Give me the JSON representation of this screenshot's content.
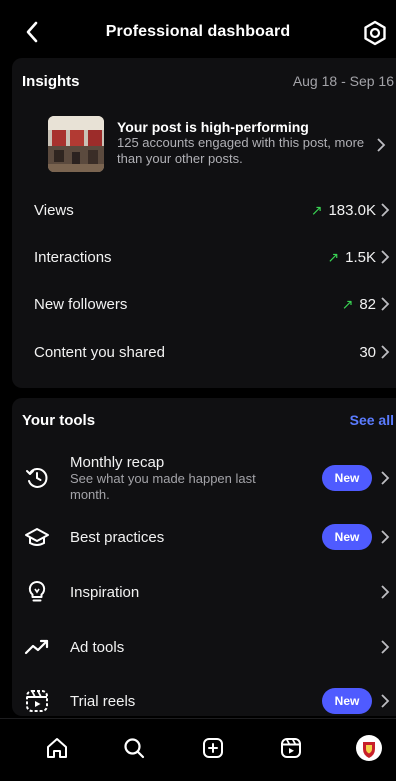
{
  "header": {
    "title": "Professional dashboard"
  },
  "insights": {
    "heading": "Insights",
    "date_range": "Aug 18 - Sep 16",
    "post": {
      "title": "Your post is high-performing",
      "description": "125 accounts engaged with this post, more than your other posts."
    },
    "metrics": [
      {
        "label": "Views",
        "value": "183.0K",
        "trend": "up"
      },
      {
        "label": "Interactions",
        "value": "1.5K",
        "trend": "up"
      },
      {
        "label": "New followers",
        "value": "82",
        "trend": "up"
      },
      {
        "label": "Content you shared",
        "value": "30",
        "trend": ""
      }
    ]
  },
  "tools": {
    "heading": "Your tools",
    "see_all": "See all",
    "items": [
      {
        "name": "Monthly recap",
        "subtitle": "See what you made happen last month.",
        "badge": "New",
        "icon": "recap-icon"
      },
      {
        "name": "Best practices",
        "subtitle": "",
        "badge": "New",
        "icon": "graduation-cap-icon"
      },
      {
        "name": "Inspiration",
        "subtitle": "",
        "badge": "",
        "icon": "lightbulb-icon"
      },
      {
        "name": "Ad tools",
        "subtitle": "",
        "badge": "",
        "icon": "trend-arrow-icon"
      },
      {
        "name": "Trial reels",
        "subtitle": "",
        "badge": "New",
        "icon": "reels-icon"
      }
    ]
  },
  "tabbar": [
    "home-icon",
    "search-icon",
    "create-icon",
    "reels-icon",
    "profile-avatar"
  ],
  "colors": {
    "accent": "#4f5bff",
    "link": "#5b7cff",
    "trend_up": "#39d353",
    "background": "#000000"
  }
}
